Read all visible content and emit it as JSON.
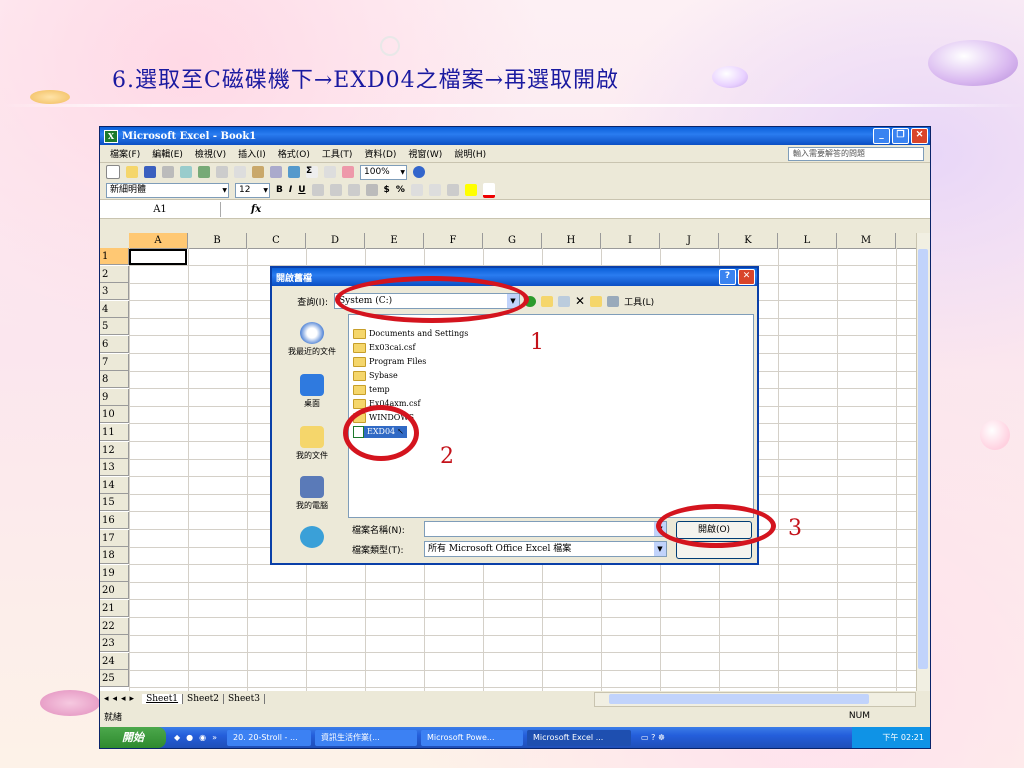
{
  "slide": {
    "title": "6.選取至C磁碟機下→EXD04之檔案→再選取開啟"
  },
  "excel": {
    "title": "Microsoft Excel - Book1",
    "menu": [
      "檔案(F)",
      "編輯(E)",
      "檢視(V)",
      "插入(I)",
      "格式(O)",
      "工具(T)",
      "資料(D)",
      "視窗(W)",
      "說明(H)"
    ],
    "help_placeholder": "輸入需要解答的問題",
    "toolbar": {
      "zoom": "100%",
      "font": "新細明體",
      "size": "12",
      "bold": "B",
      "italic": "I",
      "underline": "U",
      "currency": "$",
      "percent": "%"
    },
    "namebox": "A1",
    "fx": "fx",
    "columns": [
      "A",
      "B",
      "C",
      "D",
      "E",
      "F",
      "G",
      "H",
      "I",
      "J",
      "K",
      "L",
      "M"
    ],
    "rows": [
      "1",
      "2",
      "3",
      "4",
      "5",
      "6",
      "7",
      "8",
      "9",
      "10",
      "11",
      "12",
      "13",
      "14",
      "15",
      "16",
      "17",
      "18",
      "19",
      "20",
      "21",
      "22",
      "23",
      "24",
      "25"
    ],
    "sheets": [
      "Sheet1",
      "Sheet2",
      "Sheet3"
    ],
    "status": "就緒",
    "num": "NUM"
  },
  "dialog": {
    "title": "開啟舊檔",
    "lookin_label": "查詢(I):",
    "lookin_value": "System (C:)",
    "tools_label": "工具(L)",
    "places": [
      "我最近的文件",
      "桌面",
      "我的文件",
      "我的電腦"
    ],
    "files": [
      "Documents and Settings",
      "Ex03cai.csf",
      "Program Files",
      "Sybase",
      "temp",
      "Ex04axm.csf",
      "WINDOWS",
      "EXD04"
    ],
    "filename_label": "檔案名稱(N):",
    "filetype_label": "檔案類型(T):",
    "filetype_value": "所有 Microsoft Office Excel 檔案",
    "open_button": "開啟(O)"
  },
  "annotations": {
    "step1": "1",
    "step2": "2",
    "step3": "3"
  },
  "taskbar": {
    "start": "開始",
    "items": [
      "20. 20-Stroll - ...",
      "資訊生活作業(...",
      "Microsoft Powe...",
      "Microsoft Excel ..."
    ],
    "clock": "下午 02:21"
  }
}
